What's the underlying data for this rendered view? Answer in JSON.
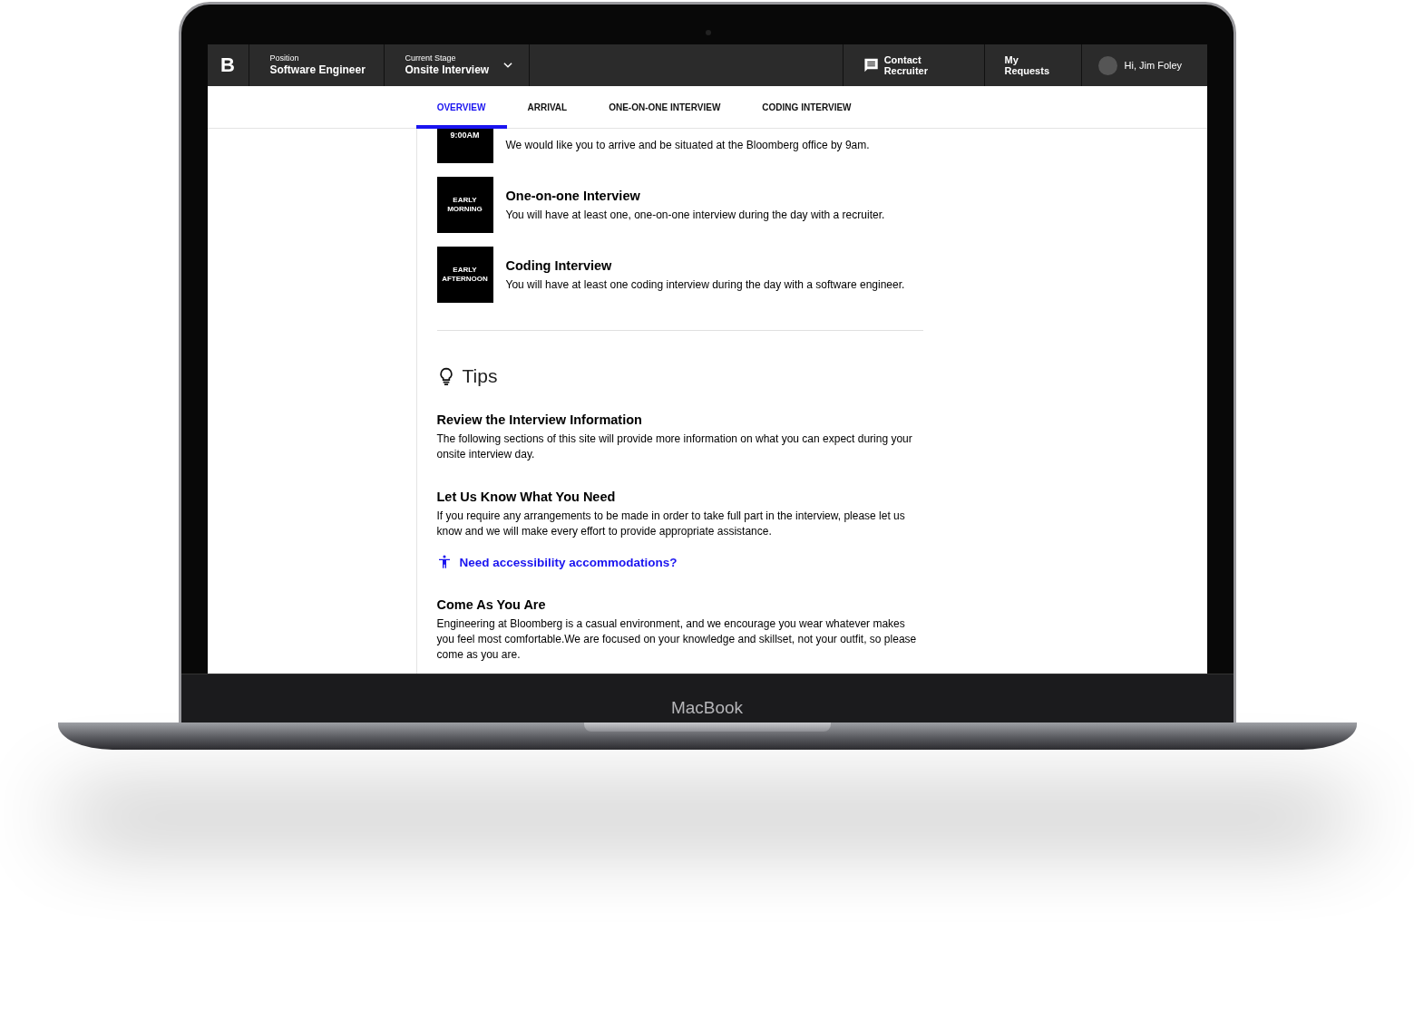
{
  "device": {
    "label": "MacBook"
  },
  "header": {
    "logo": "B",
    "position": {
      "label": "Position",
      "value": "Software Engineer"
    },
    "stage": {
      "label": "Current Stage",
      "value": "Onsite Interview"
    },
    "actions": [
      {
        "kind": "contact",
        "label": "Contact Recruiter"
      },
      {
        "kind": "link",
        "label": "My Requests"
      },
      {
        "kind": "user",
        "label": "Hi, Jim Foley"
      }
    ]
  },
  "tabs": [
    {
      "label": "OVERVIEW",
      "selected": true
    },
    {
      "label": "ARRIVAL",
      "selected": false
    },
    {
      "label": "ONE-ON-ONE INTERVIEW",
      "selected": false
    },
    {
      "label": "CODING INTERVIEW",
      "selected": false
    }
  ],
  "schedule": [
    {
      "time": "9:00AM",
      "description": "We would like you to arrive and be situated at the Bloomberg office by 9am."
    },
    {
      "time": "EARLY MORNING",
      "title": "One-on-one Interview",
      "description": "You will have at least one, one-on-one interview during the day with a recruiter."
    },
    {
      "time": "EARLY AFTERNOON",
      "title": "Coding Interview",
      "description": "You will have at least one coding interview during the day with a software engineer."
    }
  ],
  "tips": {
    "heading": "Tips",
    "items": [
      {
        "title": "Review the Interview Information",
        "body": "The following sections of this site will provide more information on what you can expect during your onsite interview day."
      },
      {
        "title": "Let Us Know What You Need",
        "body": "If you require any arrangements to be made in order to take full part in the interview, please let us know and we will make every effort to provide appropriate assistance.",
        "link": "Need accessibility accommodations?"
      },
      {
        "title": "Come As You Are",
        "body": "Engineering at Bloomberg is a casual environment, and we encourage you wear whatever makes you feel most comfortable.We are focused on your knowledge and skillset, not your outfit, so please come as you are."
      }
    ]
  }
}
